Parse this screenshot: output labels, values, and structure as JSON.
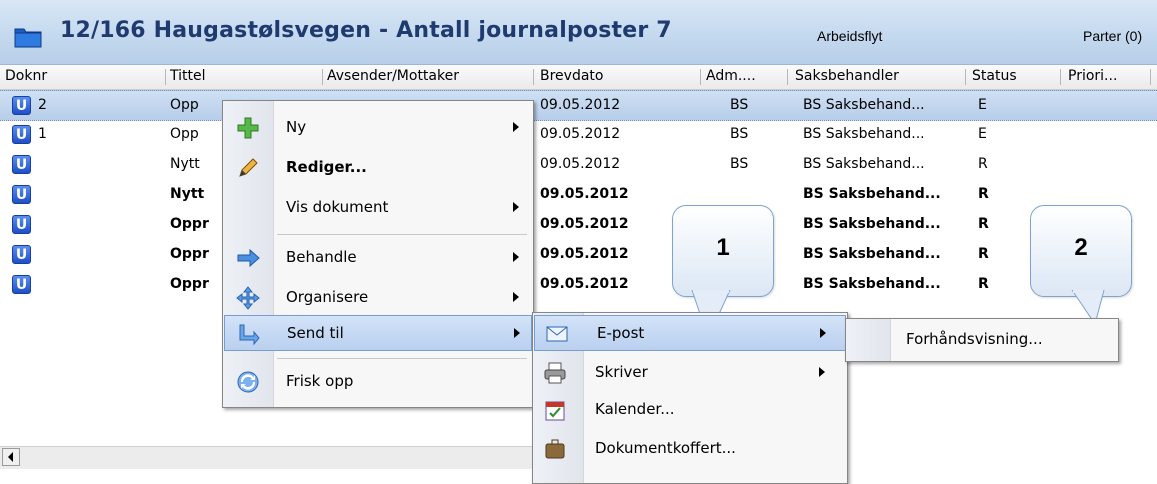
{
  "header": {
    "title": "12/166 Haugastølsvegen - Antall journalposter 7",
    "tab_arbeidsflyt": "Arbeidsflyt",
    "tab_parter": "Parter (0)"
  },
  "columns": [
    "Doknr",
    "Tittel",
    "Avsender/Mottaker",
    "Brevdato",
    "Adm....",
    "Saksbehandler",
    "Status",
    "Priori..."
  ],
  "rows": [
    {
      "doknr": "2",
      "tittel": "Opp",
      "avsender": "",
      "brevdato": "09.05.2012",
      "adm": "BS",
      "saksbehandler": "BS Saksbehand...",
      "status": "E",
      "bold": false,
      "selected": true
    },
    {
      "doknr": "1",
      "tittel": "Opp",
      "avsender": "",
      "brevdato": "09.05.2012",
      "adm": "BS",
      "saksbehandler": "BS Saksbehand...",
      "status": "E",
      "bold": false,
      "selected": false
    },
    {
      "doknr": "",
      "tittel": "Nytt",
      "avsender": "",
      "brevdato": "09.05.2012",
      "adm": "BS",
      "saksbehandler": "BS Saksbehand...",
      "status": "R",
      "bold": false,
      "selected": false
    },
    {
      "doknr": "",
      "tittel": "Nytt",
      "avsender": "",
      "brevdato": "09.05.2012",
      "adm": "",
      "saksbehandler": "BS Saksbehand...",
      "status": "R",
      "bold": true,
      "selected": false
    },
    {
      "doknr": "",
      "tittel": "Oppr",
      "avsender": "",
      "brevdato": "09.05.2012",
      "adm": "",
      "saksbehandler": "BS Saksbehand...",
      "status": "R",
      "bold": true,
      "selected": false
    },
    {
      "doknr": "",
      "tittel": "Oppr",
      "avsender": "",
      "brevdato": "09.05.2012",
      "adm": "",
      "saksbehandler": "BS Saksbehand...",
      "status": "R",
      "bold": true,
      "selected": false
    },
    {
      "doknr": "",
      "tittel": "Oppr",
      "avsender": "",
      "brevdato": "09.05.2012",
      "adm": "",
      "saksbehandler": "BS Saksbehand...",
      "status": "R",
      "bold": true,
      "selected": false
    }
  ],
  "row_icon_letter": "U",
  "context_menu": {
    "ny": "Ny",
    "rediger": "Rediger...",
    "vis_dokument": "Vis dokument",
    "behandle": "Behandle",
    "organisere": "Organisere",
    "send_til": "Send til",
    "frisk_opp": "Frisk opp"
  },
  "send_til_menu": {
    "epost": "E-post",
    "skriver": "Skriver",
    "kalender": "Kalender...",
    "dokumentkoffert": "Dokumentkoffert..."
  },
  "epost_menu": {
    "forhandsvisning": "Forhåndsvisning..."
  },
  "callouts": [
    "1",
    "2"
  ],
  "colors": {
    "header_title": "#1f3a6e",
    "selection": "#b7cde9",
    "menu_highlight": "#b9d0ef",
    "row_icon": "#1d4fc7"
  }
}
